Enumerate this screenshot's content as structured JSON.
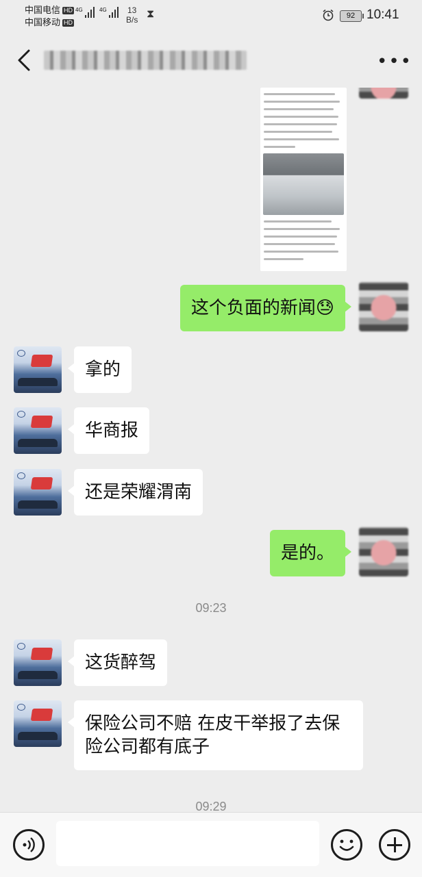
{
  "status_bar": {
    "carrier1": "中国电信",
    "carrier2": "中国移动",
    "hd": "HD",
    "net1": "4G",
    "net2": "4G",
    "speed_value": "13",
    "speed_unit": "B/s",
    "battery": "92",
    "time": "10:41"
  },
  "header": {
    "back_icon": "chevron-left-icon",
    "title": "",
    "more_label": "•••"
  },
  "messages": [
    {
      "side": "right",
      "type": "image",
      "content": "news-article-screenshot"
    },
    {
      "side": "right",
      "type": "text",
      "text": "这个负面的新闻😓"
    },
    {
      "side": "left",
      "type": "text",
      "text": "拿的"
    },
    {
      "side": "left",
      "type": "text",
      "text": "华商报"
    },
    {
      "side": "left",
      "type": "text",
      "text": "还是荣耀渭南"
    },
    {
      "side": "right",
      "type": "text",
      "text": "是的。"
    },
    {
      "type": "timestamp",
      "text": "09:23"
    },
    {
      "side": "left",
      "type": "text",
      "text": "这货醉驾"
    },
    {
      "side": "left",
      "type": "text",
      "text": "保险公司不赔 在皮干举报了去保险公司都有底子"
    },
    {
      "type": "timestamp",
      "text": "09:29"
    }
  ],
  "input_bar": {
    "voice_icon": "voice-icon",
    "placeholder": "",
    "emoji_icon": "smile-icon",
    "plus_icon": "plus-icon"
  },
  "colors": {
    "background": "#ededed",
    "my_bubble": "#95ec69",
    "their_bubble": "#ffffff"
  }
}
